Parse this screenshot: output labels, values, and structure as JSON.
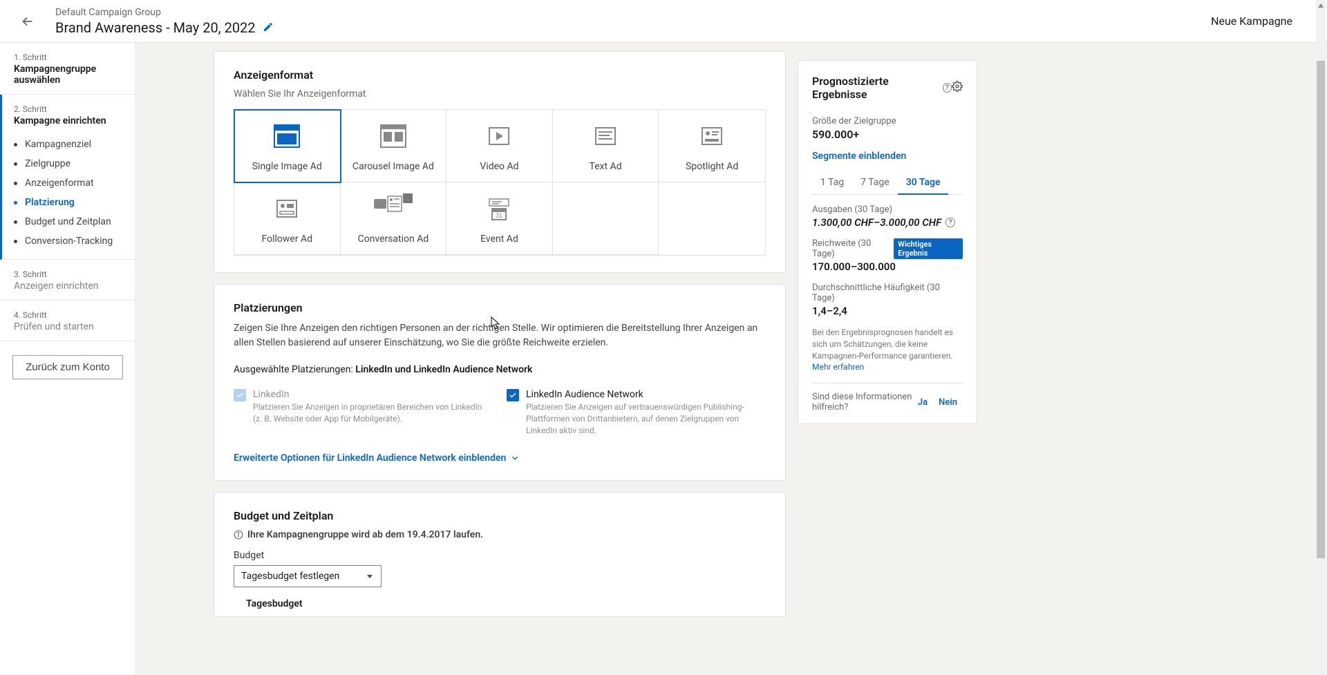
{
  "header": {
    "group": "Default Campaign Group",
    "campaign": "Brand Awareness - May 20, 2022",
    "right_action": "Neue Kampagne"
  },
  "sidebar": {
    "steps": [
      {
        "label": "1. Schritt",
        "title": "Kampagnengruppe auswählen"
      },
      {
        "label": "2. Schritt",
        "title": "Kampagne einrichten"
      },
      {
        "label": "3. Schritt",
        "title": "Anzeigen einrichten"
      },
      {
        "label": "4. Schritt",
        "title": "Prüfen und starten"
      }
    ],
    "substeps": [
      "Kampagnenziel",
      "Zielgruppe",
      "Anzeigenformat",
      "Platzierung",
      "Budget und Zeitplan",
      "Conversion-Tracking"
    ],
    "back_button": "Zurück zum Konto"
  },
  "ad_format": {
    "title": "Anzeigenformat",
    "subtitle": "Wählen Sie Ihr Anzeigenformat",
    "options": [
      "Single Image Ad",
      "Carousel Image Ad",
      "Video Ad",
      "Text Ad",
      "Spotlight Ad",
      "Follower Ad",
      "Conversation Ad",
      "Event Ad"
    ]
  },
  "placements": {
    "title": "Platzierungen",
    "desc": "Zeigen Sie Ihre Anzeigen den richtigen Personen an der richtigen Stelle. Wir optimieren die Bereitstellung Ihrer Anzeigen an allen Stellen basierend auf unserer Einschätzung, wo Sie die größte Reichweite erzielen.",
    "selected_label": "Ausgewählte Platzierungen: ",
    "selected_value": "LinkedIn und LinkedIn Audience Network",
    "opt1_title": "LinkedIn",
    "opt1_desc": "Platzieren Sie Anzeigen in proprietären Bereichen von LinkedIn (z. B. Website oder App für Mobilgeräte).",
    "opt2_title": "LinkedIn Audience Network",
    "opt2_desc": "Platzieren Sie Anzeigen auf vertrauenswürdigen Publishing-Plattformen von Drittanbietern, auf denen Zielgruppen von LinkedIn aktiv sind.",
    "expand": "Erweiterte Optionen für LinkedIn Audience Network einblenden"
  },
  "budget": {
    "title": "Budget und Zeitplan",
    "info": "Ihre Kampagnengruppe wird ab dem 19.4.2017 laufen.",
    "field_label": "Budget",
    "select_value": "Tagesbudget festlegen",
    "sub_field": "Tagesbudget"
  },
  "forecast": {
    "title": "Prognostizierte Ergebnisse",
    "audience_label": "Größe der Zielgruppe",
    "audience_value": "590.000+",
    "segments_link": "Segmente einblenden",
    "tabs": [
      "1 Tag",
      "7 Tage",
      "30 Tage"
    ],
    "spend_label": "Ausgaben (30 Tage)",
    "spend_value": "1.300,00 CHF–3.000,00 CHF",
    "reach_label": "Reichweite (30 Tage)",
    "reach_badge": "Wichtiges Ergebnis",
    "reach_value": "170.000–300.000",
    "freq_label": "Durchschnittliche Häufigkeit (30 Tage)",
    "freq_value": "1,4–2,4",
    "disclaimer": "Bei den Ergebnisprognosen handelt es sich um Schätzungen, die keine Kampagnen-Performance garantieren. ",
    "learn_more": "Mehr erfahren",
    "helpful_q": "Sind diese Informationen hilfreich?",
    "yes": "Ja",
    "no": "Nein"
  }
}
